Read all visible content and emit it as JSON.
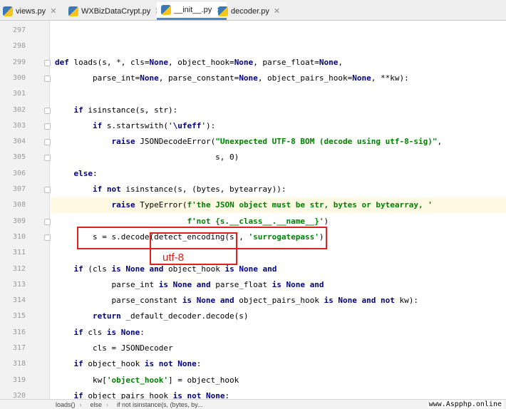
{
  "tabs": [
    {
      "label": "views.py",
      "active": false
    },
    {
      "label": "WXBizDataCrypt.py",
      "active": false
    },
    {
      "label": "__init__.py",
      "active": true
    },
    {
      "label": "decoder.py",
      "active": false
    }
  ],
  "lines": [
    {
      "num": "297",
      "text": ""
    },
    {
      "num": "298",
      "text": ""
    },
    {
      "num": "299",
      "text": "def loads(s, *, cls=None, object_hook=None, parse_float=None,"
    },
    {
      "num": "300",
      "text": "        parse_int=None, parse_constant=None, object_pairs_hook=None, **kw):"
    },
    {
      "num": "301",
      "text": ""
    },
    {
      "num": "302",
      "text": "    if isinstance(s, str):"
    },
    {
      "num": "303",
      "text": "        if s.startswith('\\ufeff'):"
    },
    {
      "num": "304",
      "text": "            raise JSONDecodeError(\"Unexpected UTF-8 BOM (decode using utf-8-sig)\","
    },
    {
      "num": "305",
      "text": "                                  s, 0)"
    },
    {
      "num": "306",
      "text": "    else:"
    },
    {
      "num": "307",
      "text": "        if not isinstance(s, (bytes, bytearray)):"
    },
    {
      "num": "308",
      "text": "            raise TypeError(f'the JSON object must be str, bytes or bytearray, '"
    },
    {
      "num": "309",
      "text": "                            f'not {s.__class__.__name__}')"
    },
    {
      "num": "310",
      "text": "        s = s.decode(detect_encoding(s), 'surrogatepass')"
    },
    {
      "num": "311",
      "text": ""
    },
    {
      "num": "312",
      "text": "    if (cls is None and object_hook is None and"
    },
    {
      "num": "313",
      "text": "            parse_int is None and parse_float is None and"
    },
    {
      "num": "314",
      "text": "            parse_constant is None and object_pairs_hook is None and not kw):"
    },
    {
      "num": "315",
      "text": "        return _default_decoder.decode(s)"
    },
    {
      "num": "316",
      "text": "    if cls is None:"
    },
    {
      "num": "317",
      "text": "        cls = JSONDecoder"
    },
    {
      "num": "318",
      "text": "    if object_hook is not None:"
    },
    {
      "num": "319",
      "text": "        kw['object_hook'] = object_hook"
    },
    {
      "num": "320",
      "text": "    if object_pairs_hook is not None:"
    }
  ],
  "annotation": {
    "label": "utf-8",
    "color": "#e0201c"
  },
  "breadcrumb": [
    "loads()",
    "else",
    "if not isinstance(s, (bytes, by..."
  ],
  "watermark": "www.Aspphp.online",
  "colors": {
    "keyword": "#000080",
    "string": "#008000",
    "highlight_row": "#fdf9e3",
    "active_tab_underline": "#4a88c7"
  }
}
